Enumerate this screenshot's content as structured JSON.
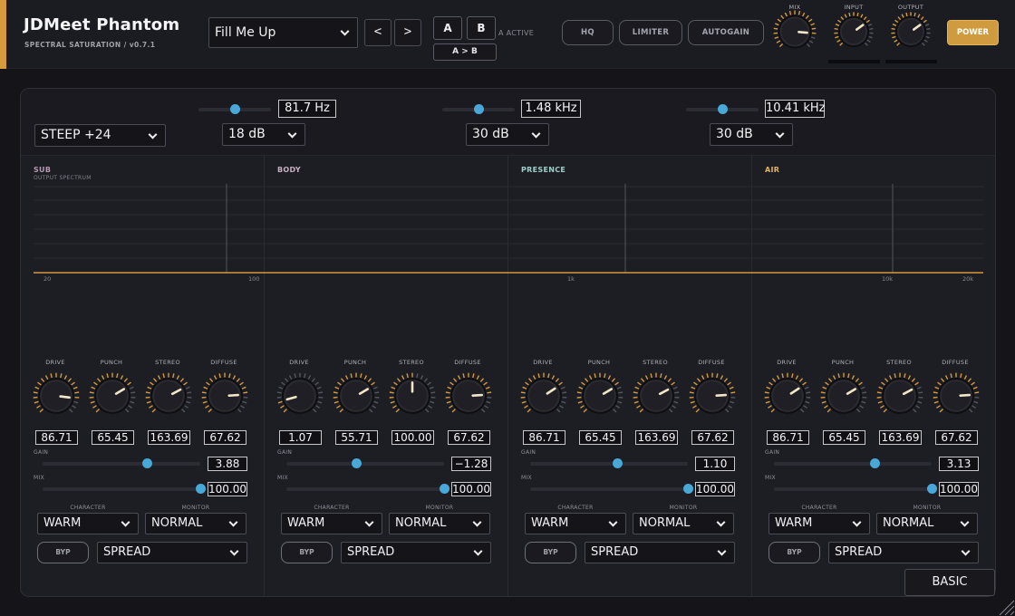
{
  "header": {
    "title": "JDMeet Phantom",
    "subtitle": "SPECTRAL SATURATION  /  v0.7.1",
    "preset": "Fill Me Up",
    "prev_label": "<",
    "next_label": ">",
    "a_label": "A",
    "b_label": "B",
    "ab_copy_label": "A > B",
    "ab_status": "A ACTIVE",
    "hq_label": "HQ",
    "limiter_label": "LIMITER",
    "autogain_label": "AUTOGAIN",
    "power_label": "POWER",
    "mix_label": "MIX",
    "input_label": "INPUT",
    "output_label": "OUTPUT",
    "mix_value": 0.85,
    "input_value": 0.7,
    "output_value": 0.7
  },
  "crossover": {
    "slope": "STEEP +24",
    "points": [
      {
        "freq": "81.7 Hz",
        "slope": "18 dB",
        "position": 0.5
      },
      {
        "freq": "1.48 kHz",
        "slope": "30 dB",
        "position": 0.5
      },
      {
        "freq": "10.41 kHz",
        "slope": "30 dB",
        "position": 0.5
      }
    ]
  },
  "spectrum": {
    "label": "OUTPUT SPECTRUM",
    "ticks": [
      "20",
      "100",
      "1k",
      "10k",
      "20k"
    ]
  },
  "colors": {
    "accent": "#d49a3c",
    "slider": "#48a8d8",
    "sub": "#b39ab0",
    "body": "#c4b0c0",
    "presence": "#9fd0c8",
    "air": "#e6b25a"
  },
  "bands": [
    {
      "name": "SUB",
      "params": [
        {
          "label": "DRIVE",
          "value": "86.71",
          "norm": 0.86
        },
        {
          "label": "PUNCH",
          "value": "65.45",
          "norm": 0.72
        },
        {
          "label": "STEREO",
          "value": "163.69",
          "norm": 0.73
        },
        {
          "label": "DIFFUSE",
          "value": "67.62",
          "norm": 0.82
        }
      ],
      "gain_label": "GAIN",
      "gain": "3.88",
      "gain_pos": 0.66,
      "mix_label": "MIX",
      "mix": "100.00",
      "mix_pos": 1.0,
      "character_label": "CHARACTER",
      "character": "WARM",
      "monitor_label": "MONITOR",
      "monitor": "NORMAL",
      "bypass_label": "BYP",
      "spread": "SPREAD"
    },
    {
      "name": "BODY",
      "params": [
        {
          "label": "DRIVE",
          "value": "1.07",
          "norm": 0.11
        },
        {
          "label": "PUNCH",
          "value": "55.71",
          "norm": 0.72
        },
        {
          "label": "STEREO",
          "value": "100.00",
          "norm": 0.5
        },
        {
          "label": "DIFFUSE",
          "value": "67.62",
          "norm": 0.82
        }
      ],
      "gain_label": "GAIN",
      "gain": "−1.28",
      "gain_pos": 0.44,
      "mix_label": "MIX",
      "mix": "100.00",
      "mix_pos": 1.0,
      "character_label": "CHARACTER",
      "character": "WARM",
      "monitor_label": "MONITOR",
      "monitor": "NORMAL",
      "bypass_label": "BYP",
      "spread": "SPREAD"
    },
    {
      "name": "PRESENCE",
      "params": [
        {
          "label": "DRIVE",
          "value": "86.71",
          "norm": 0.71
        },
        {
          "label": "PUNCH",
          "value": "65.45",
          "norm": 0.72
        },
        {
          "label": "STEREO",
          "value": "163.69",
          "norm": 0.73
        },
        {
          "label": "DIFFUSE",
          "value": "67.62",
          "norm": 0.82
        }
      ],
      "gain_label": "GAIN",
      "gain": "1.10",
      "gain_pos": 0.55,
      "mix_label": "MIX",
      "mix": "100.00",
      "mix_pos": 1.0,
      "character_label": "CHARACTER",
      "character": "WARM",
      "monitor_label": "MONITOR",
      "monitor": "NORMAL",
      "bypass_label": "BYP",
      "spread": "SPREAD"
    },
    {
      "name": "AIR",
      "params": [
        {
          "label": "DRIVE",
          "value": "86.71",
          "norm": 0.71
        },
        {
          "label": "PUNCH",
          "value": "65.45",
          "norm": 0.72
        },
        {
          "label": "STEREO",
          "value": "163.69",
          "norm": 0.73
        },
        {
          "label": "DIFFUSE",
          "value": "67.62",
          "norm": 0.82
        }
      ],
      "gain_label": "GAIN",
      "gain": "3.13",
      "gain_pos": 0.64,
      "mix_label": "MIX",
      "mix": "100.00",
      "mix_pos": 1.0,
      "character_label": "CHARACTER",
      "character": "WARM",
      "monitor_label": "MONITOR",
      "monitor": "NORMAL",
      "bypass_label": "BYP",
      "spread": "SPREAD"
    }
  ],
  "footer": {
    "basic_label": "BASIC"
  }
}
